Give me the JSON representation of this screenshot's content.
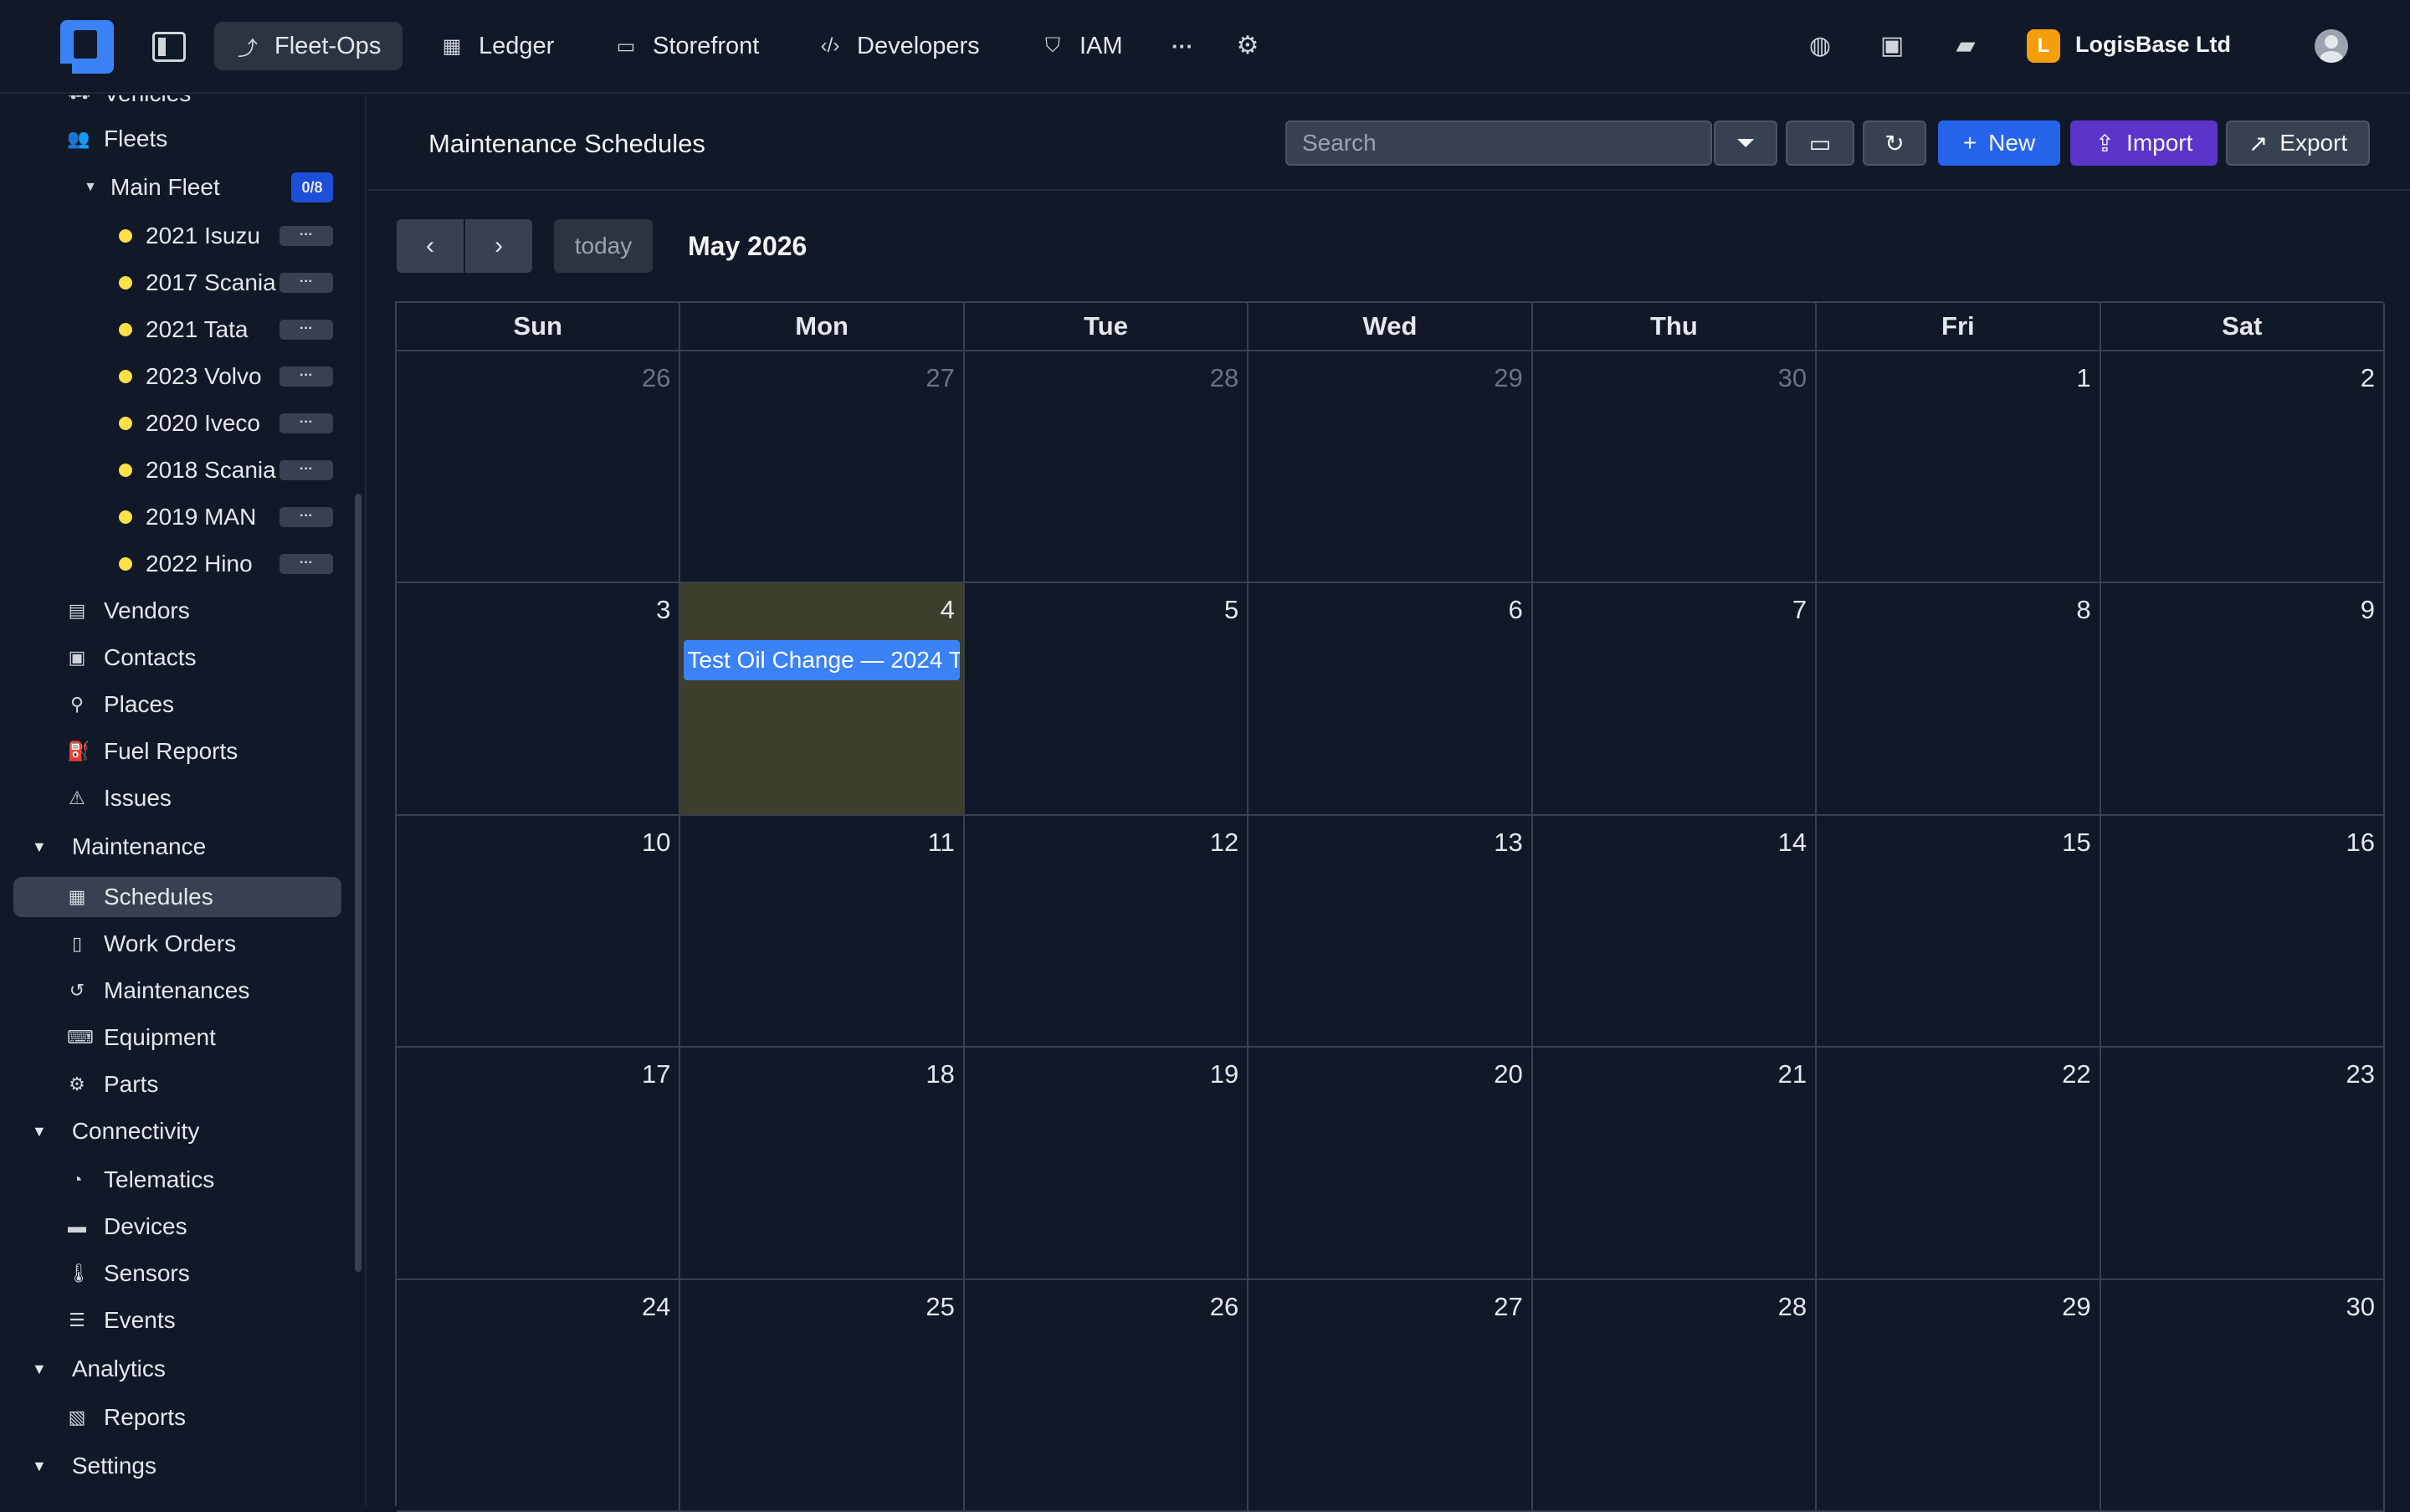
{
  "topbar": {
    "tabs": [
      {
        "label": "Fleet-Ops",
        "icon": "route-icon",
        "active": true
      },
      {
        "label": "Ledger",
        "icon": "calculator-icon",
        "active": false
      },
      {
        "label": "Storefront",
        "icon": "store-icon",
        "active": false
      },
      {
        "label": "Developers",
        "icon": "code-icon",
        "active": false
      },
      {
        "label": "IAM",
        "icon": "shield-icon",
        "active": false
      }
    ],
    "more_label": "···",
    "org_initial": "L",
    "org_name": "LogisBase Ltd",
    "org_color": "#f59e0b",
    "accent": "#3b82f6"
  },
  "sidebar": {
    "vehicles_label": "Vehicles",
    "fleets_label": "Fleets",
    "main_fleet": {
      "label": "Main Fleet",
      "badge": "0/8"
    },
    "vehicles": [
      "2021 Isuzu",
      "2017 Scania",
      "2021 Tata",
      "2023 Volvo",
      "2020 Iveco",
      "2018 Scania",
      "2019 MAN",
      "2022 Hino"
    ],
    "vehicle_more": "···",
    "items_top": [
      {
        "label": "Vendors",
        "icon": "warehouse-icon"
      },
      {
        "label": "Contacts",
        "icon": "contact-card-icon"
      },
      {
        "label": "Places",
        "icon": "map-pin-icon"
      },
      {
        "label": "Fuel Reports",
        "icon": "fuel-pump-icon"
      },
      {
        "label": "Issues",
        "icon": "warning-icon"
      }
    ],
    "maintenance": {
      "label": "Maintenance",
      "items": [
        {
          "label": "Schedules",
          "icon": "calendar-icon",
          "active": true
        },
        {
          "label": "Work Orders",
          "icon": "clipboard-icon"
        },
        {
          "label": "Maintenances",
          "icon": "history-icon"
        },
        {
          "label": "Equipment",
          "icon": "keyboard-icon"
        },
        {
          "label": "Parts",
          "icon": "gear-icon"
        }
      ]
    },
    "connectivity": {
      "label": "Connectivity",
      "items": [
        {
          "label": "Telematics",
          "icon": "satellite-dish-icon"
        },
        {
          "label": "Devices",
          "icon": "hard-drive-icon"
        },
        {
          "label": "Sensors",
          "icon": "thermometer-icon"
        },
        {
          "label": "Events",
          "icon": "list-icon"
        }
      ]
    },
    "analytics": {
      "label": "Analytics",
      "items": [
        {
          "label": "Reports",
          "icon": "file-chart-icon"
        }
      ]
    },
    "settings": {
      "label": "Settings"
    }
  },
  "main": {
    "title": "Maintenance Schedules",
    "search_placeholder": "Search",
    "buttons": {
      "new": "New",
      "import": "Import",
      "export": "Export"
    },
    "calendar": {
      "today_label": "today",
      "month": "May 2026",
      "weekdays": [
        "Sun",
        "Mon",
        "Tue",
        "Wed",
        "Thu",
        "Fri",
        "Sat"
      ],
      "weeks": [
        [
          "26",
          "27",
          "28",
          "29",
          "30",
          "1",
          "2"
        ],
        [
          "3",
          "4",
          "5",
          "6",
          "7",
          "8",
          "9"
        ],
        [
          "10",
          "11",
          "12",
          "13",
          "14",
          "15",
          "16"
        ],
        [
          "17",
          "18",
          "19",
          "20",
          "21",
          "22",
          "23"
        ],
        [
          "24",
          "25",
          "26",
          "27",
          "28",
          "29",
          "30"
        ]
      ],
      "other_month_days_week1": [
        "26",
        "27",
        "28",
        "29",
        "30"
      ],
      "today_highlight_color": "#3d3e2c",
      "event": {
        "title": "Test Oil Change — 2024 T",
        "day": "4",
        "color": "#3b82f6"
      }
    }
  }
}
